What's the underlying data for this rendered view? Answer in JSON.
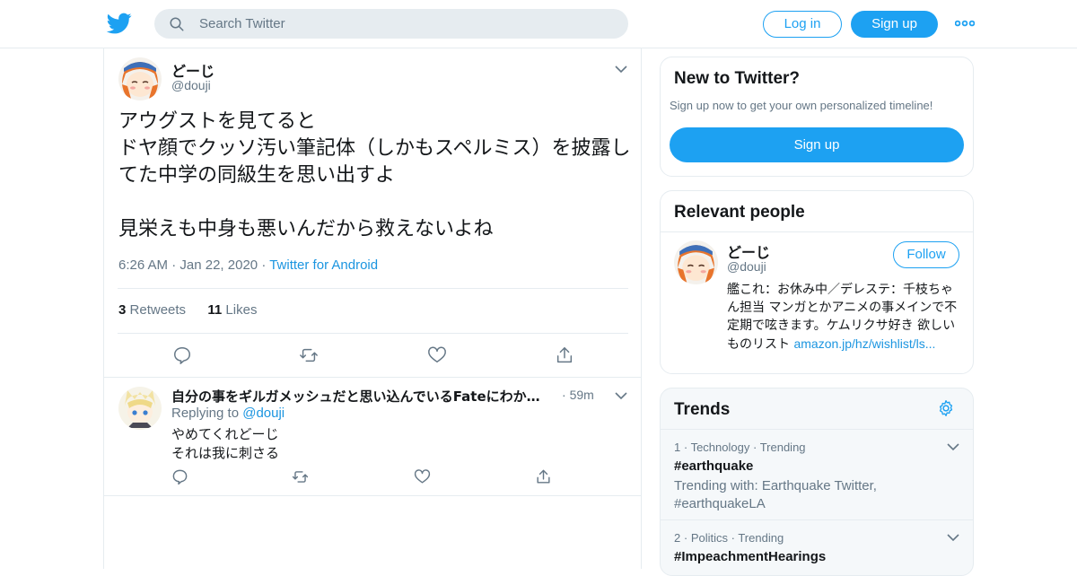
{
  "colors": {
    "accent": "#1da1f2",
    "link": "#1b95e0",
    "muted": "#657786",
    "border": "#e6ecf0"
  },
  "header": {
    "logo_icon": "twitter-bird-icon",
    "search_placeholder": "Search Twitter",
    "login_label": "Log in",
    "signup_label": "Sign up",
    "more_icon": "more-dots-icon"
  },
  "tweet": {
    "name": "どーじ",
    "handle": "@douji",
    "text": "アウグストを見てると\nドヤ顔でクッソ汚い筆記体（しかもスペルミス）を披露してた中学の同級生を思い出すよ\n\n見栄えも中身も悪いんだから救えないよね",
    "time": "6:26 AM",
    "date": "Jan 22, 2020",
    "source": "Twitter for Android",
    "retweets_count": "3",
    "retweets_label": "Retweets",
    "likes_count": "11",
    "likes_label": "Likes"
  },
  "reply": {
    "name": "自分の事をギルガメッシュだと思い込んでいるFateにわかの...",
    "time": "59m",
    "replying_label": "Replying to",
    "replying_to": "@douji",
    "text": "やめてくれどーじ\nそれは我に刺さる"
  },
  "sidebar": {
    "new_title": "New to Twitter?",
    "new_sub": "Sign up now to get your own personalized timeline!",
    "new_signup": "Sign up",
    "relevant_title": "Relevant people",
    "person": {
      "name": "どーじ",
      "handle": "@douji",
      "follow_label": "Follow",
      "bio": "艦これ：お休み中／デレステ：千枝ちゃん担当 マンガとかアニメの事メインで不定期で呟きます。ケムリクサ好き 欲しいものリスト",
      "link": "amazon.jp/hz/wishlist/ls..."
    },
    "trends_title": "Trends",
    "trends": [
      {
        "rank": "1",
        "category": "Technology",
        "status": "Trending",
        "tag": "#earthquake",
        "with": "Trending with: Earthquake Twitter, #earthquakeLA"
      },
      {
        "rank": "2",
        "category": "Politics",
        "status": "Trending",
        "tag": "#ImpeachmentHearings",
        "with": ""
      }
    ]
  }
}
